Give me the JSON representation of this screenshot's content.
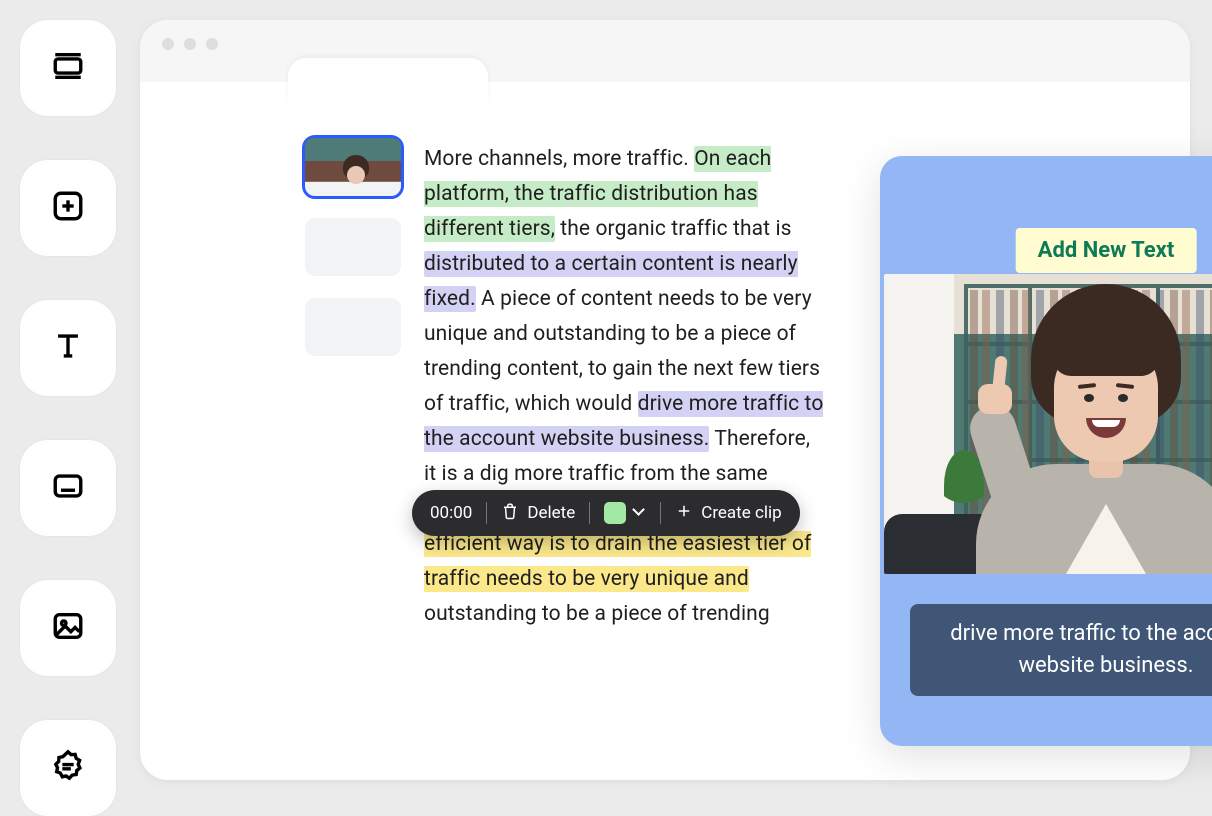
{
  "sidebar": {
    "tools": [
      {
        "name": "layout-tool"
      },
      {
        "name": "add-tool"
      },
      {
        "name": "text-tool"
      },
      {
        "name": "subtitle-tool"
      },
      {
        "name": "image-tool"
      },
      {
        "name": "badge-tool"
      }
    ]
  },
  "thumbnails": {
    "selected_index": 0,
    "count": 3
  },
  "transcript": {
    "segments": [
      {
        "text": "More channels, more traffic. ",
        "highlight": null
      },
      {
        "text": "On each platform, the traffic distribution has different tiers,",
        "highlight": "green"
      },
      {
        "text": " the organic traffic that is ",
        "highlight": null
      },
      {
        "text": "distributed to a certain content is nearly fixed.",
        "highlight": "purple"
      },
      {
        "text": " A piece of content needs to be very unique and outstanding to be a piece of trending content, to gain the next few tiers of traffic, which would ",
        "highlight": null
      },
      {
        "text": "drive more traffic to the account website business.",
        "highlight": "purple"
      },
      {
        "text": " Therefore, it is a dig more traffic from the same platform in terms of efficiency. ",
        "highlight": null
      },
      {
        "text": "A more efficient way is to drain the easiest tier of traffic needs to be very unique and",
        "highlight": "yellow"
      },
      {
        "text": " outstanding to be a piece of trending",
        "highlight": null
      }
    ]
  },
  "clip_toolbar": {
    "timecode": "00:00",
    "delete_label": "Delete",
    "swatch_color": "#a2e9a5",
    "create_label": "Create clip"
  },
  "preview": {
    "add_text_label": "Add New Text",
    "caption_text": "drive more traffic to the account website business.",
    "accent_bg": "#93b6f5"
  }
}
